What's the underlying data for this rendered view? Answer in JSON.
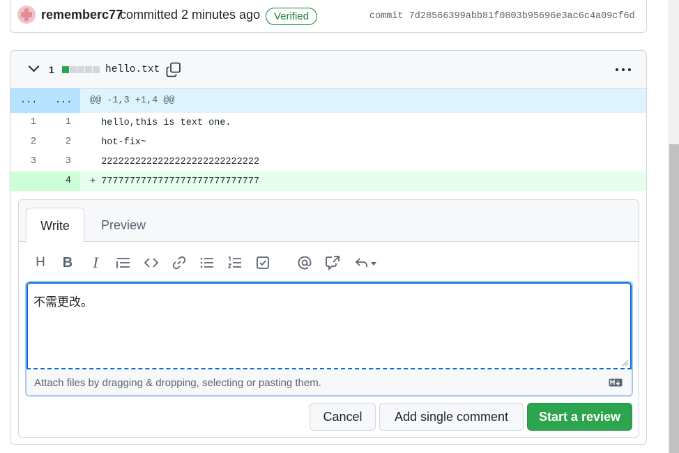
{
  "commit": {
    "author": "rememberc77",
    "action": "committed 2 minutes ago",
    "badge": "Verified",
    "hash": "commit 7d28566399abb81f0803b95696e3ac6c4a09cf6d"
  },
  "file": {
    "changes": "1",
    "name": "hello.txt",
    "diffstat": [
      "added",
      "neutral",
      "neutral",
      "neutral",
      "neutral"
    ]
  },
  "diff": {
    "hunk": {
      "old_dots": "...",
      "new_dots": "...",
      "header": "@@ -1,3 +1,4 @@"
    },
    "lines": [
      {
        "old": "1",
        "new": "1",
        "text": "  hello,this is text one.",
        "type": "context"
      },
      {
        "old": "2",
        "new": "2",
        "text": "  hot-fix~",
        "type": "context"
      },
      {
        "old": "3",
        "new": "3",
        "text": "  2222222222222222222222222222",
        "type": "context"
      },
      {
        "old": "",
        "new": "4",
        "text": "+ 7777777777777777777777777777",
        "type": "add"
      }
    ]
  },
  "comment_form": {
    "tabs": {
      "write": "Write",
      "preview": "Preview"
    },
    "toolbar": {
      "heading": "H",
      "bold": "B",
      "italic": "I"
    },
    "body": "不需更改。",
    "attach_hint": "Attach files by dragging & dropping, selecting or pasting them.",
    "buttons": {
      "cancel": "Cancel",
      "single": "Add single comment",
      "review": "Start a review"
    }
  },
  "colors": {
    "accent_green": "#2da44e",
    "verified": "#1a7f37",
    "hunk_bg": "#ddf4ff",
    "add_bg": "#e6ffec",
    "focus_blue": "#0969da"
  }
}
